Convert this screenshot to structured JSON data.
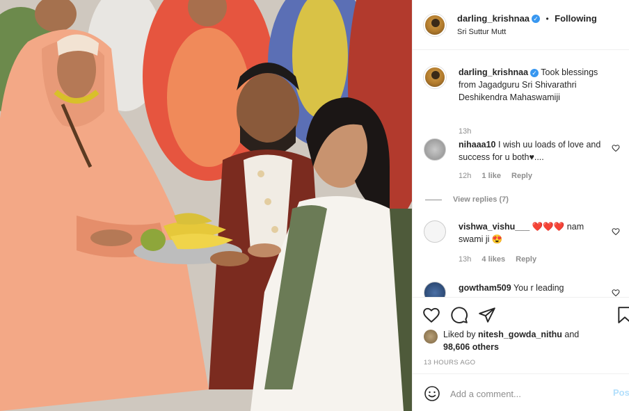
{
  "post": {
    "author": "darling_krishnaa",
    "verified_mark": "✓",
    "separator": "•",
    "follow_label": "Following",
    "location": "Sri Suttur Mutt"
  },
  "caption": {
    "username": "darling_krishnaa",
    "text": "Took blessings from Jagadguru Sri Shivarathri Deshikendra Mahaswamiji",
    "time": "13h"
  },
  "comments": [
    {
      "username": "nihaaa10",
      "text": "I wish uu loads of love and success for u both♥....",
      "time": "12h",
      "likes": "1 like",
      "reply": "Reply",
      "view_replies": "View replies (7)"
    },
    {
      "username": "vishwa_vishu___",
      "text": "❤️❤️❤️ nam swami ji 😍",
      "time": "13h",
      "likes": "4 likes",
      "reply": "Reply"
    },
    {
      "username": "gowtham509",
      "text": "You r leading"
    }
  ],
  "actions": {
    "like_icon": "heart-icon",
    "comment_icon": "comment-icon",
    "share_icon": "share-icon",
    "save_icon": "bookmark-icon"
  },
  "likes": {
    "prefix": "Liked by",
    "user": "nitesh_gowda_nithu",
    "and": "and",
    "count": "98,606 others"
  },
  "timestamp": "13 HOURS AGO",
  "add_comment": {
    "placeholder": "Add a comment...",
    "post_label": "Post"
  },
  "colors": {
    "verified": "#3897f0",
    "post_disabled": "#b2dffc",
    "meta": "#8e8e8e"
  }
}
